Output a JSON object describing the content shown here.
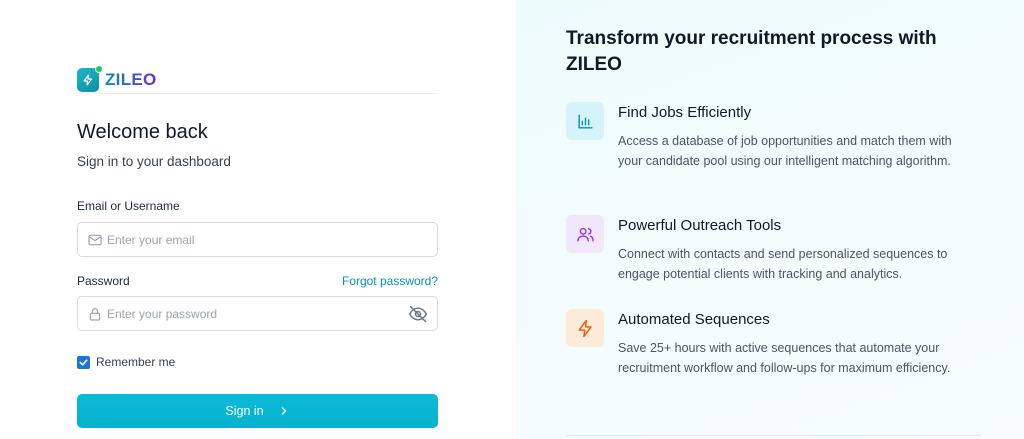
{
  "brand": {
    "name": "ZILEO",
    "accent": "#06b6d4",
    "gradient_end": "#6d28d9"
  },
  "login": {
    "title": "Welcome back",
    "subtitle": "Sign in to your dashboard",
    "email": {
      "label": "Email or Username",
      "placeholder": "Enter your email",
      "value": "",
      "icon": "mail-icon"
    },
    "password": {
      "label": "Password",
      "placeholder": "Enter your password",
      "value": "",
      "icon": "lock-icon",
      "toggle_icon": "eye-off-icon"
    },
    "forgot_label": "Forgot password?",
    "remember": {
      "label": "Remember me",
      "checked": true
    },
    "submit_label": "Sign in"
  },
  "promo": {
    "title": "Transform your recruitment process with ZILEO",
    "features": [
      {
        "icon": "bar-chart-icon",
        "color": "#0891b2",
        "title": "Find Jobs Efficiently",
        "description": "Access a database of job opportunities and match them with your candidate pool using our intelligent matching algorithm."
      },
      {
        "icon": "users-icon",
        "color": "#9333ea",
        "title": "Powerful Outreach Tools",
        "description": "Connect with contacts and send personalized sequences to engage potential clients with tracking and analytics."
      },
      {
        "icon": "lightning-icon",
        "color": "#ea580c",
        "title": "Automated Sequences",
        "description": "Save 25+ hours with active sequences that automate your recruitment workflow and follow-ups for maximum efficiency."
      }
    ]
  }
}
